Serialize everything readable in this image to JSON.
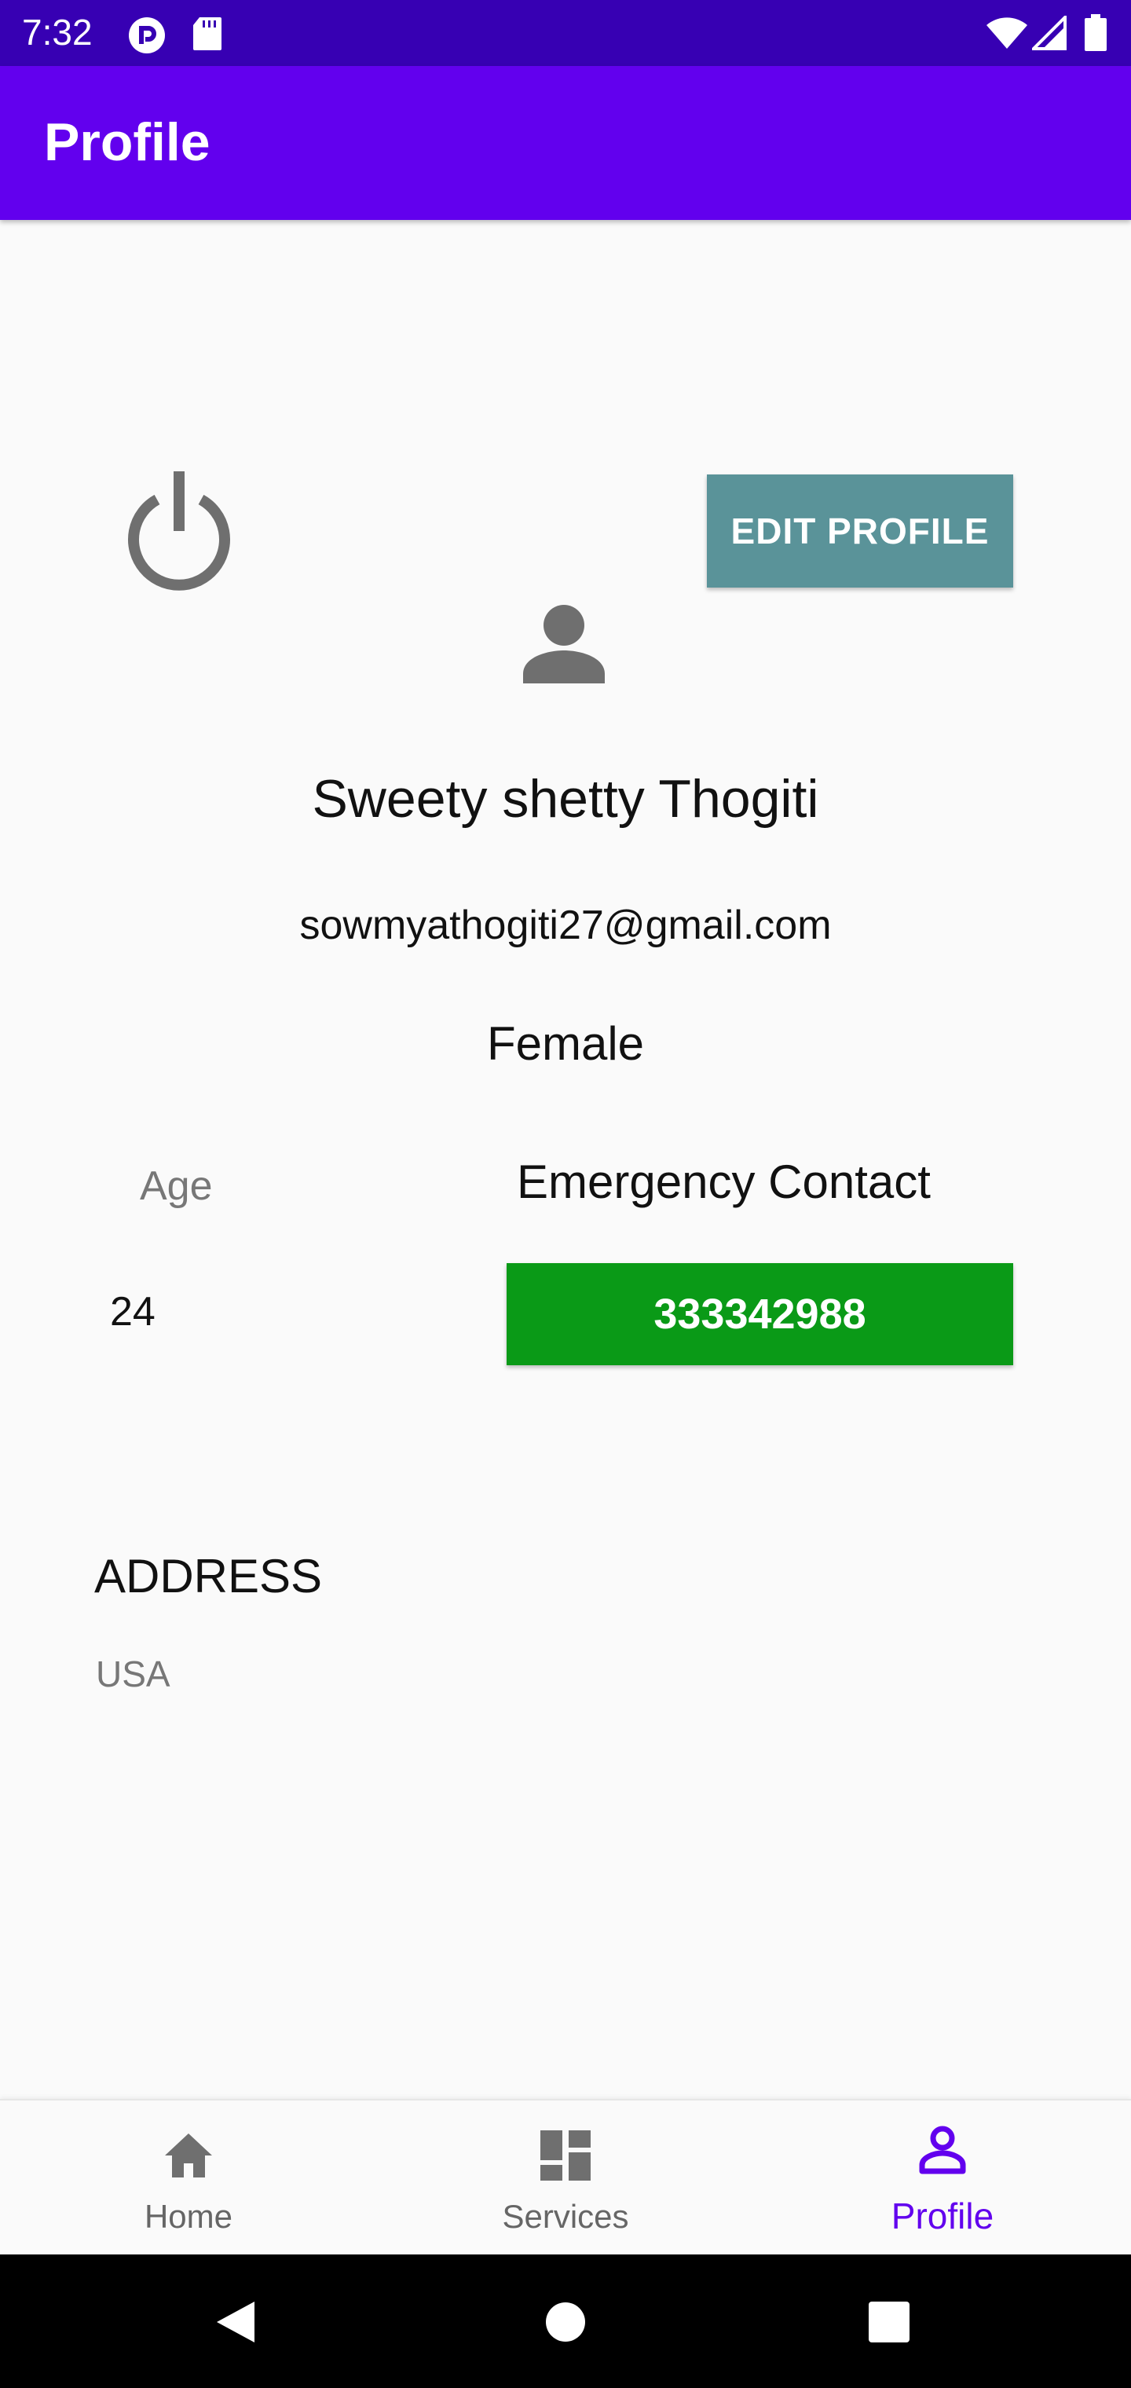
{
  "status_bar": {
    "time": "7:32",
    "icons": [
      "pocket-casts-icon",
      "sd-card-icon",
      "wifi-icon",
      "signal-icon",
      "battery-icon"
    ]
  },
  "app_bar": {
    "title": "Profile"
  },
  "profile": {
    "edit_button_label": "EDIT PROFILE",
    "name": "Sweety shetty Thogiti",
    "email": "sowmyathogiti27@gmail.com",
    "gender": "Female",
    "age_label": "Age",
    "age_value": "24",
    "emergency_label": "Emergency Contact",
    "emergency_number": "333342988",
    "address_heading": "ADDRESS",
    "address_value": "USA"
  },
  "bottom_nav": {
    "items": [
      {
        "label": "Home",
        "icon": "home-icon",
        "active": false
      },
      {
        "label": "Services",
        "icon": "dashboard-icon",
        "active": false
      },
      {
        "label": "Profile",
        "icon": "person-outline-icon",
        "active": true
      }
    ]
  },
  "colors": {
    "status_bar": "#3700b3",
    "app_bar": "#6200ee",
    "edit_button": "#5a9399",
    "contact_button": "#0a9a17",
    "nav_active": "#6200ee"
  }
}
